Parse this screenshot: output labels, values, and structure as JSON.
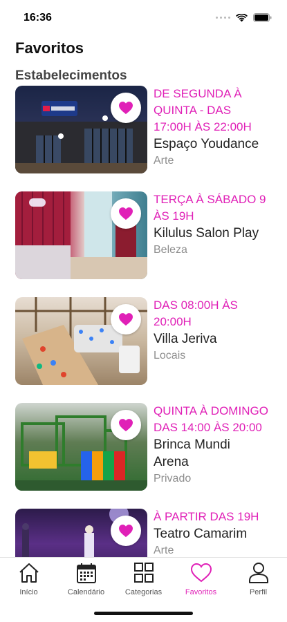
{
  "status_bar": {
    "time": "16:36"
  },
  "page": {
    "title": "Favoritos",
    "section": "Estabelecimentos"
  },
  "colors": {
    "accent": "#e020b7",
    "text": "#222222",
    "muted": "#8d8d8d"
  },
  "establishments": [
    {
      "schedule": "DE SEGUNDA À\nQUINTA - DAS\n17:00H ÀS 22:00H",
      "name": "Espaço Youdance",
      "category": "Arte",
      "favorite": true
    },
    {
      "schedule": "TERÇA À SÁBADO 9\nÀS 19H",
      "name": "Kilulus Salon Play",
      "category": "Beleza",
      "favorite": true
    },
    {
      "schedule": "DAS 08:00H ÀS\n20:00H",
      "name": "Villa Jeriva",
      "category": "Locais",
      "favorite": true
    },
    {
      "schedule": "QUINTA À DOMINGO\nDAS 14:00 ÀS 20:00",
      "name": "Brinca Mundi\nArena",
      "category": "Privado",
      "favorite": true
    },
    {
      "schedule": "À PARTIR DAS 19H",
      "name": "Teatro Camarim",
      "category": "Arte",
      "favorite": true
    }
  ],
  "tabs": [
    {
      "label": "Início",
      "icon": "home-icon",
      "active": false
    },
    {
      "label": "Calendário",
      "icon": "calendar-icon",
      "active": false
    },
    {
      "label": "Categorias",
      "icon": "grid-icon",
      "active": false
    },
    {
      "label": "Favoritos",
      "icon": "heart-icon",
      "active": true
    },
    {
      "label": "Perfil",
      "icon": "person-icon",
      "active": false
    }
  ]
}
